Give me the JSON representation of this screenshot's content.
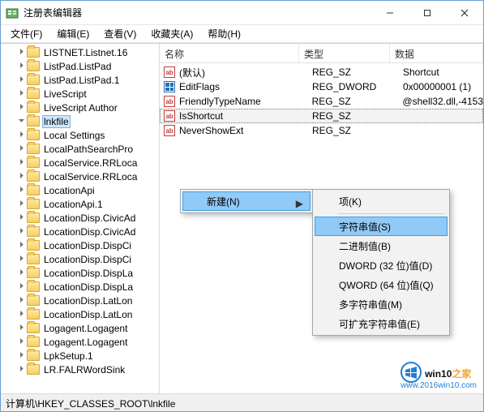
{
  "window": {
    "title": "注册表编辑器"
  },
  "menu": {
    "file": "文件(F)",
    "edit": "编辑(E)",
    "view": "查看(V)",
    "favorites": "收藏夹(A)",
    "help": "帮助(H)"
  },
  "tree": {
    "items": [
      "LISTNET.Listnet.16",
      "ListPad.ListPad",
      "ListPad.ListPad.1",
      "LiveScript",
      "LiveScript Author",
      "lnkfile",
      "Local Settings",
      "LocalPathSearchPro",
      "LocalService.RRLoca",
      "LocalService.RRLoca",
      "LocationApi",
      "LocationApi.1",
      "LocationDisp.CivicAd",
      "LocationDisp.CivicAd",
      "LocationDisp.DispCi",
      "LocationDisp.DispCi",
      "LocationDisp.DispLa",
      "LocationDisp.DispLa",
      "LocationDisp.LatLon",
      "LocationDisp.LatLon",
      "Logagent.Logagent",
      "Logagent.Logagent",
      "LpkSetup.1",
      "LR.FALRWordSink"
    ],
    "selected_index": 5
  },
  "list": {
    "headers": {
      "name": "名称",
      "type": "类型",
      "data": "数据"
    },
    "rows": [
      {
        "icon": "string",
        "name": "(默认)",
        "type": "REG_SZ",
        "data": "Shortcut",
        "selected": false
      },
      {
        "icon": "binary",
        "name": "EditFlags",
        "type": "REG_DWORD",
        "data": "0x00000001 (1)",
        "selected": false
      },
      {
        "icon": "string",
        "name": "FriendlyTypeName",
        "type": "REG_SZ",
        "data": "@shell32.dll,-4153",
        "selected": false
      },
      {
        "icon": "string",
        "name": "IsShortcut",
        "type": "REG_SZ",
        "data": "",
        "selected": true
      },
      {
        "icon": "string",
        "name": "NeverShowExt",
        "type": "REG_SZ",
        "data": "",
        "selected": false
      }
    ]
  },
  "context_menu": {
    "new_label": "新建(N)",
    "sub": {
      "key": "项(K)",
      "string": "字符串值(S)",
      "binary": "二进制值(B)",
      "dword": "DWORD (32 位)值(D)",
      "qword": "QWORD (64 位)值(Q)",
      "multi": "多字符串值(M)",
      "expand": "可扩充字符串值(E)"
    },
    "hover_index": 1
  },
  "statusbar": {
    "path": "计算机\\HKEY_CLASSES_ROOT\\lnkfile"
  },
  "watermark": {
    "brand_main": "win10",
    "brand_tail": "之家",
    "url": "www.2016win10.com"
  }
}
